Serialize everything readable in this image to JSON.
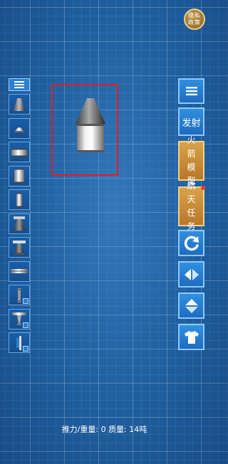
{
  "privacy_button": {
    "label": "隐私政策"
  },
  "parts_panel": {
    "menu_icon": "menu-icon",
    "items": [
      {
        "name": "nose-cone-part"
      },
      {
        "name": "small-capsule-part"
      },
      {
        "name": "wide-tank-part"
      },
      {
        "name": "medium-tank-part"
      },
      {
        "name": "narrow-tank-part"
      },
      {
        "name": "engine-part"
      },
      {
        "name": "large-engine-part"
      },
      {
        "name": "decoupler-part"
      },
      {
        "name": "strut-part",
        "locked": true
      },
      {
        "name": "landing-leg-part",
        "locked": true
      },
      {
        "name": "side-strut-part",
        "locked": true
      }
    ]
  },
  "side_buttons": {
    "menu": {
      "icon": "menu-icon"
    },
    "launch": {
      "label": "发射"
    },
    "rocket_model": {
      "label": "火箭模型"
    },
    "space_mission": {
      "label": "航天任务",
      "has_notification": true
    },
    "rotate": {
      "icon": "rotate-icon"
    },
    "flip_horizontal": {
      "icon": "flip-horizontal-icon"
    },
    "flip_vertical": {
      "icon": "flip-vertical-icon"
    },
    "skin": {
      "icon": "shirt-icon"
    }
  },
  "status": {
    "text": "推力/重量: 0 质量: 14吨"
  },
  "colors": {
    "selection": "#e31e1e",
    "accent_gold": "#c8903c",
    "accent_blue": "#2a80d6"
  }
}
